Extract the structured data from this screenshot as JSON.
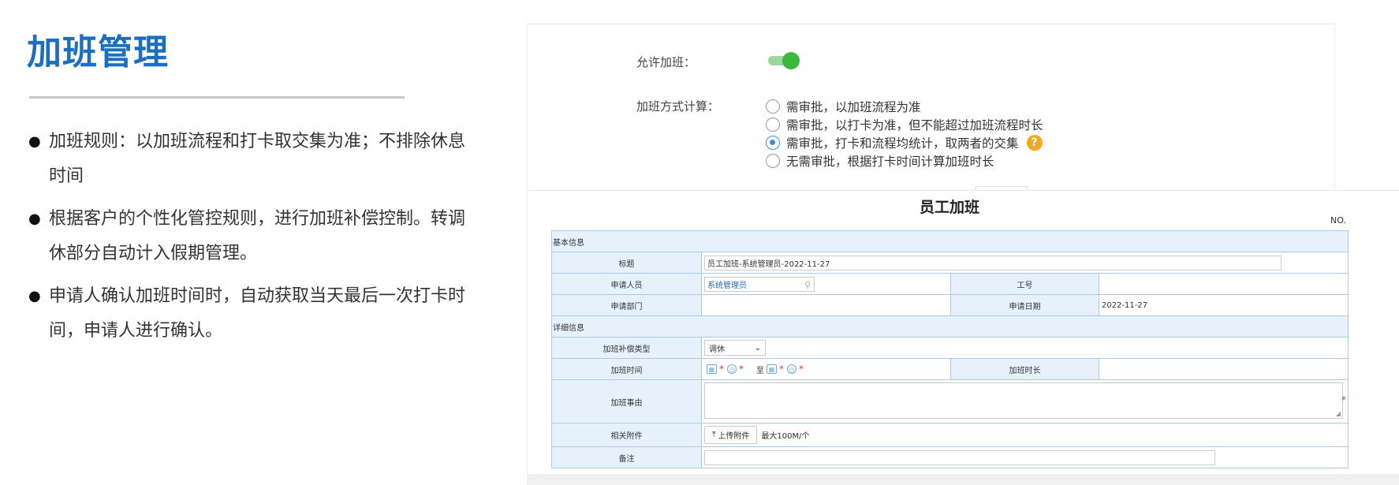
{
  "slide": {
    "title": "加班管理",
    "bullets": [
      "加班规则：以加班流程和打卡取交集为准；不排除休息时间",
      "根据客户的个性化管控规则，进行加班补偿控制。转调休部分自动计入假期管理。",
      "申请人确认加班时间时，自动获取当天最后一次打卡时间，申请人进行确认。"
    ]
  },
  "settings": {
    "allow_label": "允许加班：",
    "allow_enabled": true,
    "method_label": "加班方式计算：",
    "options": [
      "需审批，以加班流程为准",
      "需审批，以打卡为准，但不能超过加班流程时长",
      "需审批，打卡和流程均统计，取两者的交集",
      "无需审批，根据打卡时间计算加班时长"
    ],
    "selected_index": 2,
    "help_icon": "?"
  },
  "form": {
    "title": "员工加班",
    "no_label": "NO.",
    "section_basic": "基本信息",
    "section_detail": "详细信息",
    "title_label": "标题",
    "title_value": "员工加班-系统管理员-2022-11-27",
    "applicant_label": "申请人员",
    "applicant_value": "系统管理员",
    "employee_id_label": "工号",
    "employee_id_value": "",
    "department_label": "申请部门",
    "department_value": "",
    "apply_date_label": "申请日期",
    "apply_date_value": "2022-11-27",
    "compensation_label": "加班补偿类型",
    "compensation_value": "调休",
    "time_label": "加班时间",
    "to_label": "至",
    "duration_label": "加班时长",
    "reason_label": "加班事由",
    "attachment_label": "相关附件",
    "upload_label": "上传附件",
    "upload_limit": "最大100M/个",
    "remark_label": "备注"
  }
}
